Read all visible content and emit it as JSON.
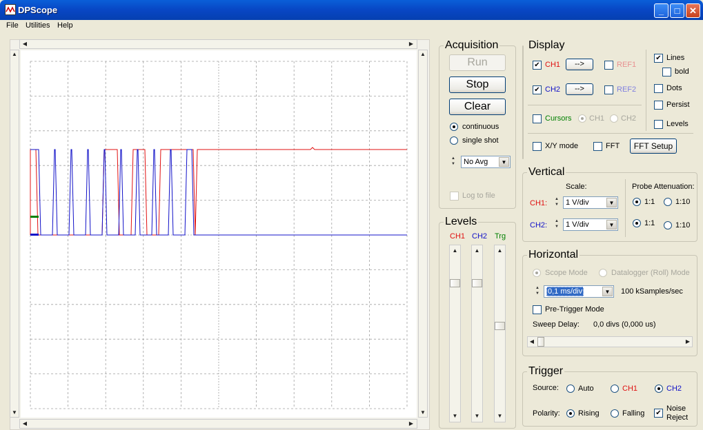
{
  "window": {
    "title": "DPScope",
    "controls": [
      "minimize",
      "maximize",
      "close"
    ]
  },
  "menu": [
    "File",
    "Utilities",
    "Help"
  ],
  "acquisition": {
    "title": "Acquisition",
    "run": "Run",
    "stop": "Stop",
    "clear": "Clear",
    "continuous": "continuous",
    "single_shot": "single shot",
    "avg": "No Avg",
    "log_to_file": "Log to file",
    "mode": "continuous"
  },
  "display": {
    "title": "Display",
    "ch1": "CH1",
    "ch2": "CH2",
    "ref1": "REF1",
    "ref2": "REF2",
    "arrow": "-->",
    "lines": "Lines",
    "bold": "bold",
    "dots": "Dots",
    "persist": "Persist",
    "levels": "Levels",
    "cursors": "Cursors",
    "cursor_ch1": "CH1",
    "cursor_ch2": "CH2",
    "xy_mode": "X/Y mode",
    "fft": "FFT",
    "fft_setup": "FFT Setup",
    "ch1_checked": true,
    "ch2_checked": true,
    "lines_checked": true
  },
  "vertical": {
    "title": "Vertical",
    "scale_label": "Scale:",
    "probe_label": "Probe Attenuation:",
    "ch1_label": "CH1:",
    "ch2_label": "CH2:",
    "ch1_scale": "1 V/div",
    "ch2_scale": "1 V/div",
    "att_1": "1:1",
    "att_10": "1:10",
    "ch1_att": "1:1",
    "ch2_att": "1:1"
  },
  "horizontal": {
    "title": "Horizontal",
    "scope_mode": "Scope Mode",
    "datalogger": "Datalogger (Roll) Mode",
    "timebase": "0,1 ms/div",
    "samplerate": "100 kSamples/sec",
    "pretrigger": "Pre-Trigger Mode",
    "sweep_delay_label": "Sweep Delay:",
    "sweep_delay_value": "0,0 divs (0,000 us)"
  },
  "trigger": {
    "title": "Trigger",
    "source_label": "Source:",
    "auto": "Auto",
    "ch1": "CH1",
    "ch2": "CH2",
    "polarity_label": "Polarity:",
    "rising": "Rising",
    "falling": "Falling",
    "noise": "Noise",
    "reject": "Reject",
    "source": "CH2",
    "polarity": "Rising",
    "noise_reject": true
  },
  "levels": {
    "title": "Levels",
    "ch1": "CH1",
    "ch2": "CH2",
    "trg": "Trg"
  },
  "colors": {
    "ch1": "#E01010",
    "ch2": "#1010C8",
    "cursors": "#008000",
    "grid": "#A0A0A0"
  },
  "icons": {
    "check": "✔",
    "up": "▲",
    "down": "▼",
    "left": "◀",
    "right": "▶"
  }
}
